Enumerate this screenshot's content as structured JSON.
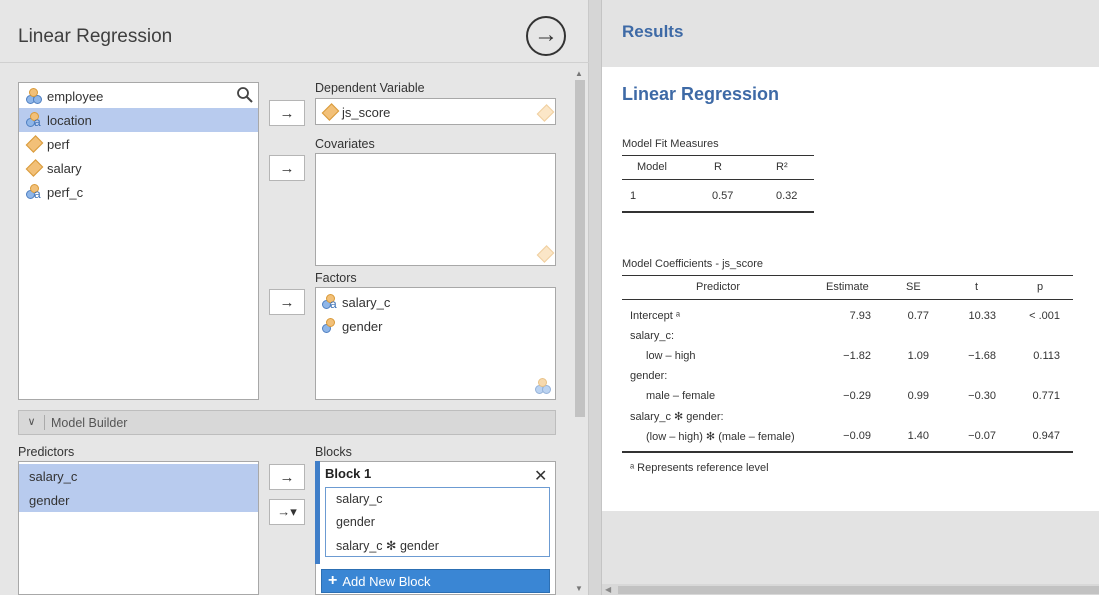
{
  "analysis": {
    "title": "Linear Regression",
    "run_icon": "arrow-circle-right-icon"
  },
  "variables": [
    {
      "name": "employee",
      "type": "nominal-multi",
      "selected": false
    },
    {
      "name": "location",
      "type": "nominal",
      "selected": true
    },
    {
      "name": "perf",
      "type": "continuous",
      "selected": false
    },
    {
      "name": "salary",
      "type": "continuous",
      "selected": false
    },
    {
      "name": "perf_c",
      "type": "nominal",
      "selected": false
    }
  ],
  "dependent": {
    "label": "Dependent Variable",
    "value": "js_score"
  },
  "covariates": {
    "label": "Covariates",
    "items": []
  },
  "factors": {
    "label": "Factors",
    "items": [
      "salary_c",
      "gender"
    ]
  },
  "buttons": {
    "arrow": "→",
    "arrow_menu": "→▾"
  },
  "model_builder": {
    "label": "Model Builder",
    "predictors_label": "Predictors",
    "predictors": [
      "salary_c",
      "gender"
    ],
    "blocks_label": "Blocks",
    "block_title": "Block 1",
    "block_close": "✕",
    "block_terms": [
      "salary_c",
      "gender",
      "salary_c ✻ gender"
    ],
    "add_block": "Add New Block"
  },
  "results": {
    "header": "Results",
    "heading": "Linear Regression",
    "fit": {
      "title": "Model Fit Measures",
      "columns": [
        "Model",
        "R",
        "R²"
      ],
      "rows": [
        [
          "1",
          "0.57",
          "0.32"
        ]
      ]
    },
    "coef": {
      "title": "Model Coefficients - js_score",
      "columns": [
        "Predictor",
        "Estimate",
        "SE",
        "t",
        "p"
      ],
      "rows": [
        {
          "label": "Intercept ᵃ",
          "indent": false,
          "vals": [
            "7.93",
            "0.77",
            "10.33",
            "< .001"
          ]
        },
        {
          "label": "salary_c:",
          "indent": false,
          "vals": [
            "",
            "",
            "",
            ""
          ]
        },
        {
          "label": "low – high",
          "indent": true,
          "vals": [
            "−1.82",
            "1.09",
            "−1.68",
            "0.113"
          ]
        },
        {
          "label": "gender:",
          "indent": false,
          "vals": [
            "",
            "",
            "",
            ""
          ]
        },
        {
          "label": "male – female",
          "indent": true,
          "vals": [
            "−0.29",
            "0.99",
            "−0.30",
            "0.771"
          ]
        },
        {
          "label": "salary_c ✻ gender:",
          "indent": false,
          "vals": [
            "",
            "",
            "",
            ""
          ]
        },
        {
          "label": "(low – high) ✻ (male – female)",
          "indent": true,
          "vals": [
            "−0.09",
            "1.40",
            "−0.07",
            "0.947"
          ]
        }
      ],
      "footnote": "ᵃ Represents reference level"
    }
  }
}
